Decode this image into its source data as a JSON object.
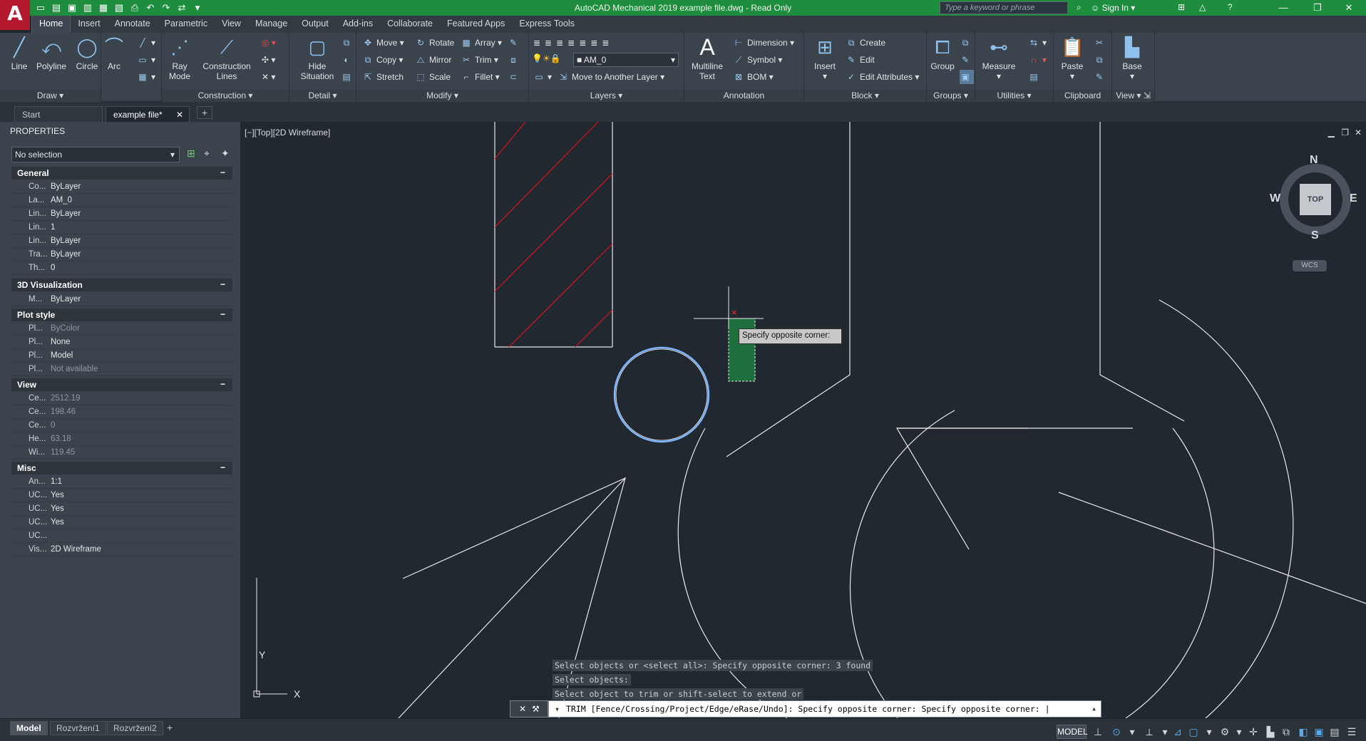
{
  "app": {
    "title": "AutoCAD Mechanical 2019    example file.dwg - Read Only",
    "logo_letter": "A",
    "search_placeholder": "Type a keyword or phrase",
    "sign_in": "Sign In"
  },
  "menu_tabs": [
    "Home",
    "Insert",
    "Annotate",
    "Parametric",
    "View",
    "Manage",
    "Output",
    "Add-ins",
    "Collaborate",
    "Featured Apps",
    "Express Tools"
  ],
  "ribbon": {
    "draw": {
      "label": "Draw",
      "line": "Line",
      "polyline": "Polyline",
      "circle": "Circle",
      "arc": "Arc"
    },
    "construction": {
      "label": "Construction",
      "ray": "Ray",
      "mode": "Mode",
      "construction": "Construction",
      "lines": "Lines"
    },
    "detail": {
      "label": "Detail",
      "hide": "Hide",
      "situation": "Situation"
    },
    "modify": {
      "label": "Modify",
      "move": "Move",
      "rotate": "Rotate",
      "array": "Array",
      "copy": "Copy",
      "mirror": "Mirror",
      "trim": "Trim",
      "stretch": "Stretch",
      "scale": "Scale",
      "fillet": "Fillet"
    },
    "layers": {
      "label": "Layers",
      "current": "AM_0",
      "move_to_layer": "Move to Another Layer"
    },
    "annotation": {
      "label": "Annotation",
      "multiline": "Multiline",
      "text": "Text",
      "dimension": "Dimension",
      "symbol": "Symbol",
      "bom": "BOM"
    },
    "block": {
      "label": "Block",
      "insert": "Insert",
      "create": "Create",
      "edit": "Edit",
      "edit_attributes": "Edit Attributes"
    },
    "groups": {
      "label": "Groups",
      "group": "Group"
    },
    "utilities": {
      "label": "Utilities",
      "measure": "Measure"
    },
    "clipboard": {
      "label": "Clipboard",
      "paste": "Paste"
    },
    "view": {
      "label": "View",
      "base": "Base"
    }
  },
  "doc_tabs": {
    "start": "Start",
    "file": "example file*"
  },
  "properties": {
    "title": "PROPERTIES",
    "selection": "No selection",
    "sections": {
      "general": {
        "label": "General",
        "rows": [
          {
            "k": "Co...",
            "v": "ByLayer"
          },
          {
            "k": "La...",
            "v": "AM_0"
          },
          {
            "k": "Lin...",
            "v": "ByLayer"
          },
          {
            "k": "Lin...",
            "v": "1"
          },
          {
            "k": "Lin...",
            "v": "ByLayer"
          },
          {
            "k": "Tra...",
            "v": "ByLayer"
          },
          {
            "k": "Th...",
            "v": "0"
          }
        ]
      },
      "viz": {
        "label": "3D Visualization",
        "rows": [
          {
            "k": "M...",
            "v": "ByLayer"
          }
        ]
      },
      "plot": {
        "label": "Plot style",
        "rows": [
          {
            "k": "Pl...",
            "v": "ByColor"
          },
          {
            "k": "Pl...",
            "v": "None"
          },
          {
            "k": "Pl...",
            "v": "Model"
          },
          {
            "k": "Pl...",
            "v": "Not available"
          }
        ]
      },
      "view": {
        "label": "View",
        "rows": [
          {
            "k": "Ce...",
            "v": "2512.19"
          },
          {
            "k": "Ce...",
            "v": "198.46"
          },
          {
            "k": "Ce...",
            "v": "0"
          },
          {
            "k": "He...",
            "v": "63.18"
          },
          {
            "k": "Wi...",
            "v": "119.45"
          }
        ]
      },
      "misc": {
        "label": "Misc",
        "rows": [
          {
            "k": "An...",
            "v": "1:1"
          },
          {
            "k": "UC...",
            "v": "Yes"
          },
          {
            "k": "UC...",
            "v": "Yes"
          },
          {
            "k": "UC...",
            "v": "Yes"
          },
          {
            "k": "UC...",
            "v": ""
          },
          {
            "k": "Vis...",
            "v": "2D Wireframe"
          }
        ]
      }
    }
  },
  "viewport": {
    "label": "[−][Top][2D Wireframe]",
    "tooltip": "Specify opposite corner:",
    "viewcube": {
      "n": "N",
      "s": "S",
      "e": "E",
      "w": "W",
      "top": "TOP",
      "wcs": "WCS"
    },
    "ucs": {
      "x": "X",
      "y": "Y"
    }
  },
  "command": {
    "history": [
      "Select objects or <select all>: Specify opposite corner: 3 found",
      "Select objects:",
      "Select object to trim or shift-select to extend or"
    ],
    "current": "TRIM [Fence/Crossing/Project/Edge/eRase/Undo]: Specify opposite corner: Specify opposite corner: "
  },
  "status": {
    "layouts": [
      "Model",
      "Rozvržení1",
      "Rozvržení2"
    ],
    "model": "MODEL"
  }
}
